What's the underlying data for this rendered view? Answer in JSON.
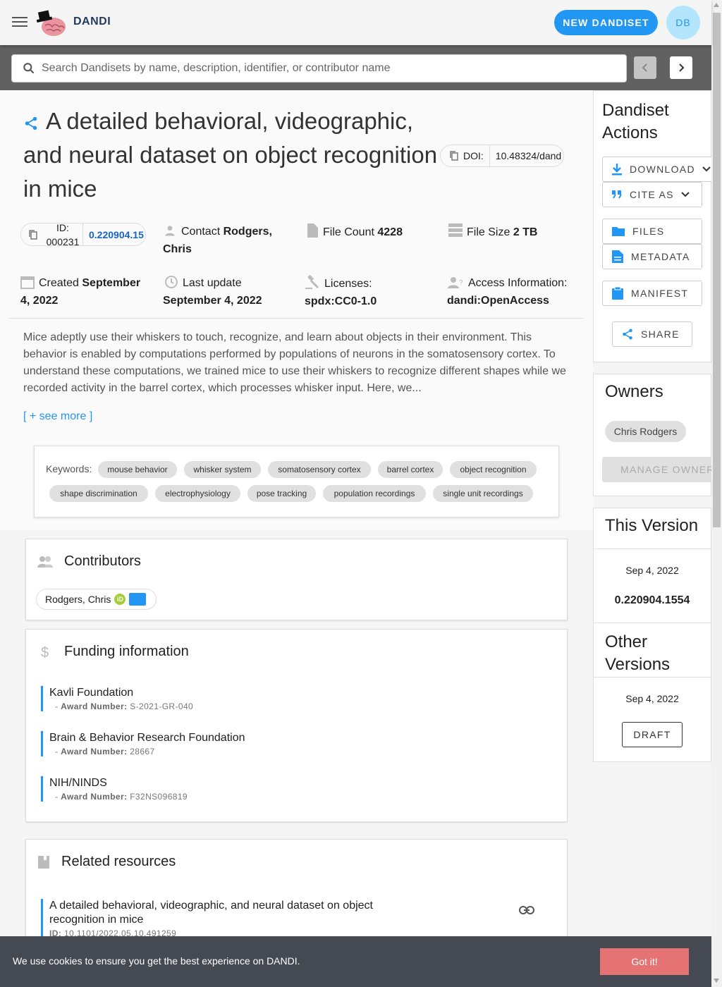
{
  "header": {
    "brand": "DANDI",
    "new_dandiset_label": "NEW DANDISET",
    "avatar_initials": "DB",
    "accent_color": "#2196f3"
  },
  "search": {
    "placeholder": "Search Dandisets by name, description, identifier, or contributor name"
  },
  "dandiset": {
    "title": "A detailed behavioral, videographic, and neural dataset on object recognition in mice",
    "doi_label": "DOI:",
    "doi_value": "10.48324/dand",
    "id_label": "ID: 000231",
    "id_version": "0.220904.15",
    "contact_label": "Contact",
    "contact_value": "Rodgers, Chris",
    "file_count_label": "File Count",
    "file_count_value": "4228",
    "file_size_label": "File Size",
    "file_size_value": "2 TB",
    "created_label": "Created",
    "created_value": "September 4, 2022",
    "last_update_label": "Last update",
    "last_update_value": "September 4, 2022",
    "licenses_label": "Licenses:",
    "licenses_value": "spdx:CC0-1.0",
    "access_label": "Access Information:",
    "access_value": "dandi:OpenAccess",
    "description": "Mice adeptly use their whiskers to touch, recognize, and learn about objects in their environment. This behavior is enabled by computations performed by populations of neurons in the somatosensory cortex. To understand these computations, we trained mice to use their whiskers to recognize different shapes while we recorded activity in the barrel cortex, which processes whisker input. Here, we...",
    "see_more": "[ + see more ]"
  },
  "keywords": {
    "label": "Keywords:",
    "items": [
      "mouse behavior",
      "whisker system",
      "somatosensory cortex",
      "barrel cortex",
      "object recognition",
      "shape discrimination",
      "electrophysiology",
      "pose tracking",
      "population recordings",
      "single unit recordings"
    ]
  },
  "contributors": {
    "heading": "Contributors",
    "items": [
      {
        "name": "Rodgers, Chris"
      }
    ]
  },
  "funding": {
    "heading": "Funding information",
    "award_label": "Award Number:",
    "items": [
      {
        "name": "Kavli Foundation",
        "award": "S-2021-GR-040"
      },
      {
        "name": "Brain & Behavior Research Foundation",
        "award": "28667"
      },
      {
        "name": "NIH/NINDS",
        "award": "F32NS096819"
      }
    ]
  },
  "related": {
    "heading": "Related resources",
    "items": [
      {
        "name": "A detailed behavioral, videographic, and neural dataset on object recognition in mice",
        "id_label": "ID:",
        "id": "10.1101/2022.05.10.491259"
      }
    ]
  },
  "sidebar": {
    "actions_heading": "Dandiset Actions",
    "download": "DOWNLOAD",
    "cite_as": "CITE AS",
    "files": "FILES",
    "metadata": "METADATA",
    "manifest": "MANIFEST",
    "share": "SHARE",
    "owners_heading": "Owners",
    "owner": "Chris Rodgers",
    "manage_owners": "MANAGE OWNERS",
    "this_version_heading": "This Version",
    "this_version_date": "Sep 4, 2022",
    "this_version_number": "0.220904.1554",
    "other_versions_heading": "Other Versions",
    "other_version_date": "Sep 4, 2022",
    "draft_label": "DRAFT"
  },
  "cookie": {
    "text": "We use cookies to ensure you get the best experience on DANDI.",
    "button": "Got it!",
    "button_color": "#e57373"
  }
}
